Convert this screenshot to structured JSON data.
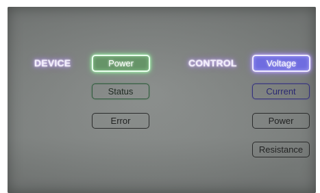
{
  "groups": {
    "device": {
      "label": "DEVICE",
      "buttons": [
        {
          "label": "Power",
          "state": "active"
        },
        {
          "label": "Status",
          "state": "inactive"
        },
        {
          "label": "Error",
          "state": "inactive"
        }
      ]
    },
    "control": {
      "label": "CONTROL",
      "buttons": [
        {
          "label": "Voltage",
          "state": "active"
        },
        {
          "label": "Current",
          "state": "inactive"
        },
        {
          "label": "Power",
          "state": "inactive"
        },
        {
          "label": "Resistance",
          "state": "inactive"
        }
      ]
    }
  },
  "colors": {
    "active_green": "#669468",
    "active_violet": "#6f6ce0",
    "label_glow": "#a37cff",
    "panel": "#838785"
  }
}
